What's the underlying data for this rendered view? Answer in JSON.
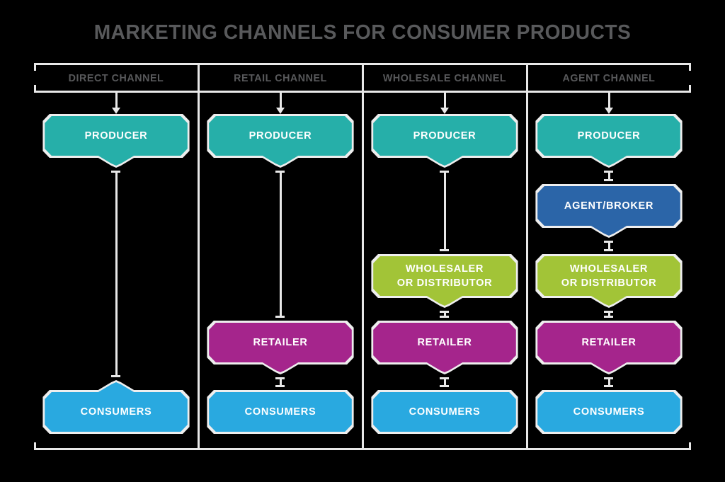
{
  "title": "MARKETING CHANNELS FOR CONSUMER PRODUCTS",
  "theme": {
    "background": "#000000",
    "rule_color": "#e8e8e8",
    "title_color": "#58595b",
    "header_color": "#58595b",
    "node_text_color": "#ffffff",
    "node_halo_color": "#eeeeee"
  },
  "node_colors": {
    "producer": "#26afa9",
    "agent": "#2b65a8",
    "wholesaler": "#a2c437",
    "retailer": "#a5258c",
    "consumers": "#29a9e0"
  },
  "columns": [
    {
      "id": "direct",
      "header": "DIRECT CHANNEL",
      "nodes": [
        {
          "id": "producer",
          "label": "PRODUCER",
          "role": "producer"
        },
        {
          "id": "consumers",
          "label": "CONSUMERS",
          "role": "consumers"
        }
      ]
    },
    {
      "id": "retail",
      "header": "RETAIL CHANNEL",
      "nodes": [
        {
          "id": "producer",
          "label": "PRODUCER",
          "role": "producer"
        },
        {
          "id": "retailer",
          "label": "RETAILER",
          "role": "retailer"
        },
        {
          "id": "consumers",
          "label": "CONSUMERS",
          "role": "consumers"
        }
      ]
    },
    {
      "id": "wholesale",
      "header": "WHOLESALE CHANNEL",
      "nodes": [
        {
          "id": "producer",
          "label": "PRODUCER",
          "role": "producer"
        },
        {
          "id": "wholesaler",
          "label": "WHOLESALER\nOR DISTRIBUTOR",
          "role": "wholesaler"
        },
        {
          "id": "retailer",
          "label": "RETAILER",
          "role": "retailer"
        },
        {
          "id": "consumers",
          "label": "CONSUMERS",
          "role": "consumers"
        }
      ]
    },
    {
      "id": "agent",
      "header": "AGENT CHANNEL",
      "nodes": [
        {
          "id": "producer",
          "label": "PRODUCER",
          "role": "producer"
        },
        {
          "id": "agent",
          "label": "AGENT/BROKER",
          "role": "agent"
        },
        {
          "id": "wholesaler",
          "label": "WHOLESALER\nOR DISTRIBUTOR",
          "role": "wholesaler"
        },
        {
          "id": "retailer",
          "label": "RETAILER",
          "role": "retailer"
        },
        {
          "id": "consumers",
          "label": "CONSUMERS",
          "role": "consumers"
        }
      ]
    }
  ]
}
